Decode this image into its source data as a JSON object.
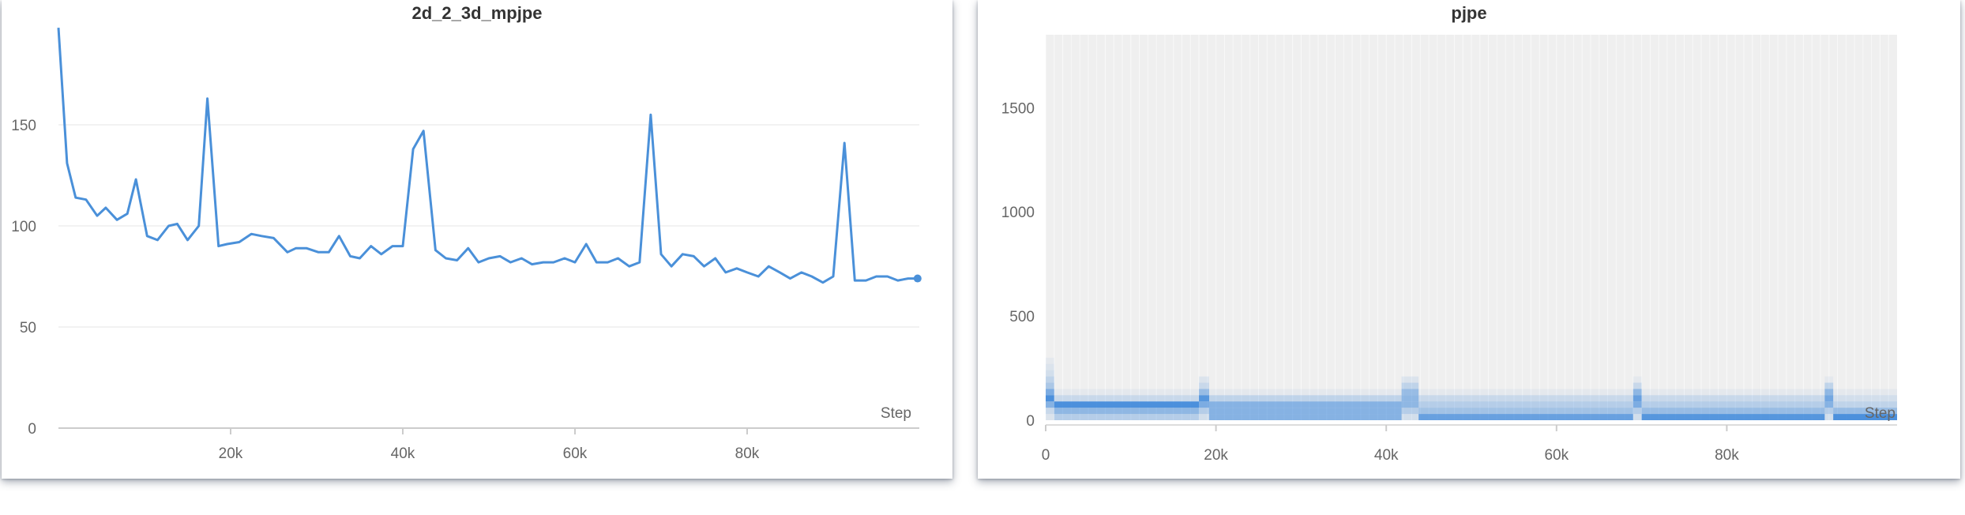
{
  "chart_data": [
    {
      "type": "line",
      "title": "2d_2_3d_mpjpe",
      "xlabel": "Step",
      "ylabel": "",
      "xlim": [
        0,
        100000
      ],
      "ylim": [
        0,
        200
      ],
      "xticks": [
        20000,
        40000,
        60000,
        80000
      ],
      "xtick_labels": [
        "20k",
        "40k",
        "60k",
        "80k"
      ],
      "yticks": [
        0,
        50,
        100,
        150
      ],
      "ytick_labels": [
        "0",
        "50",
        "100",
        "150"
      ],
      "grid": true,
      "color": "#4a90d9",
      "series": [
        {
          "x": [
            0,
            1000,
            2000,
            3200,
            4500,
            5500,
            6800,
            8000,
            9000,
            10300,
            11500,
            12800,
            13800,
            15000,
            16300,
            17300,
            18600,
            19600,
            21000,
            22400,
            23600,
            25000,
            26600,
            27600,
            28800,
            30200,
            31400,
            32600,
            33900,
            35000,
            36300,
            37500,
            38800,
            40000,
            41200,
            42400,
            43800,
            45000,
            46300,
            47600,
            48800,
            50000,
            51300,
            52500,
            53800,
            55000,
            56300,
            57500,
            58800,
            60000,
            61300,
            62500,
            63800,
            65000,
            66300,
            67500,
            68800,
            70000,
            71200,
            72500,
            73800,
            75000,
            76300,
            77500,
            78800,
            80000,
            81300,
            82500,
            83800,
            85000,
            86300,
            87500,
            88800,
            90000,
            91300,
            92500,
            93800,
            95000,
            96300,
            97500,
            98700,
            99800
          ],
          "y": [
            198,
            131,
            114,
            113,
            105,
            109,
            103,
            106,
            123,
            95,
            93,
            100,
            101,
            93,
            100,
            163,
            90,
            91,
            92,
            96,
            95,
            94,
            87,
            89,
            89,
            87,
            87,
            95,
            85,
            84,
            90,
            86,
            90,
            90,
            138,
            147,
            88,
            84,
            83,
            89,
            82,
            84,
            85,
            82,
            84,
            81,
            82,
            82,
            84,
            82,
            91,
            82,
            82,
            84,
            80,
            82,
            155,
            86,
            80,
            86,
            85,
            80,
            84,
            77,
            79,
            77,
            75,
            80,
            77,
            74,
            77,
            75,
            72,
            75,
            141,
            73,
            73,
            75,
            75,
            73,
            74,
            74
          ]
        }
      ]
    },
    {
      "type": "heatmap",
      "title": "pjpe",
      "xlabel": "Step",
      "ylabel": "",
      "xlim": [
        0,
        100000
      ],
      "ylim": [
        0,
        1850
      ],
      "xticks": [
        0,
        20000,
        40000,
        60000,
        80000
      ],
      "xtick_labels": [
        "0",
        "20k",
        "40k",
        "60k",
        "80k"
      ],
      "yticks": [
        0,
        500,
        1000,
        1500
      ],
      "ytick_labels": [
        "0",
        "500",
        "1000",
        "1500"
      ],
      "bin_edges": [
        0,
        30,
        60,
        90,
        120,
        150,
        180,
        210,
        240,
        270,
        300
      ],
      "color": "#2f7fd8",
      "background_color": "#efefef",
      "columns": [
        {
          "x_start": 0,
          "x_end": 1000,
          "density": [
            0.1,
            0.2,
            0.55,
            0.85,
            0.6,
            0.35,
            0.25,
            0.15,
            0.1,
            0.05
          ]
        },
        {
          "x_start": 1000,
          "x_end": 18000,
          "density": [
            0.3,
            0.5,
            0.85,
            0.2,
            0.05,
            0,
            0,
            0,
            0,
            0
          ]
        },
        {
          "x_start": 18000,
          "x_end": 19200,
          "density": [
            0.15,
            0.3,
            0.6,
            0.8,
            0.45,
            0.2,
            0.1,
            0,
            0,
            0
          ]
        },
        {
          "x_start": 19200,
          "x_end": 41800,
          "density": [
            0.55,
            0.55,
            0.55,
            0.25,
            0.05,
            0,
            0,
            0,
            0,
            0
          ]
        },
        {
          "x_start": 41800,
          "x_end": 43800,
          "density": [
            0.15,
            0.3,
            0.5,
            0.5,
            0.45,
            0.25,
            0.1,
            0,
            0,
            0
          ]
        },
        {
          "x_start": 43800,
          "x_end": 69000,
          "density": [
            0.7,
            0.4,
            0.3,
            0.2,
            0.05,
            0,
            0,
            0,
            0,
            0
          ]
        },
        {
          "x_start": 69000,
          "x_end": 70000,
          "density": [
            0.15,
            0.3,
            0.6,
            0.7,
            0.5,
            0.2,
            0.05,
            0,
            0,
            0
          ]
        },
        {
          "x_start": 70000,
          "x_end": 91500,
          "density": [
            0.8,
            0.45,
            0.3,
            0.2,
            0.05,
            0,
            0,
            0,
            0,
            0
          ]
        },
        {
          "x_start": 91500,
          "x_end": 92500,
          "density": [
            0.15,
            0.3,
            0.55,
            0.65,
            0.5,
            0.25,
            0.05,
            0,
            0,
            0
          ]
        },
        {
          "x_start": 92500,
          "x_end": 100000,
          "density": [
            0.85,
            0.45,
            0.25,
            0.15,
            0.05,
            0,
            0,
            0,
            0,
            0
          ]
        }
      ]
    }
  ]
}
